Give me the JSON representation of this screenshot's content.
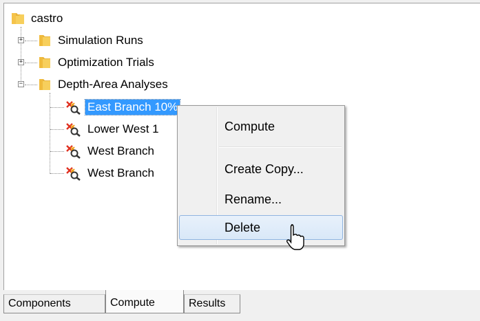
{
  "tree": {
    "root": {
      "label": "castro"
    },
    "groups": [
      {
        "label": "Simulation Runs",
        "expander": "+"
      },
      {
        "label": "Optimization Trials",
        "expander": "+"
      },
      {
        "label": "Depth-Area Analyses",
        "expander": "−"
      }
    ],
    "analyses": [
      {
        "label": "East Branch 10%",
        "selected": true
      },
      {
        "label": "Lower West 1"
      },
      {
        "label": "West Branch"
      },
      {
        "label": "West Branch"
      }
    ]
  },
  "context_menu": {
    "items": [
      {
        "label": "Compute"
      },
      {
        "label": "Create Copy..."
      },
      {
        "label": "Rename..."
      },
      {
        "label": "Delete",
        "hover": true
      }
    ]
  },
  "tabs": [
    {
      "label": "Components"
    },
    {
      "label": "Compute",
      "active": true
    },
    {
      "label": "Results"
    }
  ],
  "colors": {
    "selection": "#3399ff",
    "folder": "#f5c34a",
    "menu_hover": "#d9e8f8"
  }
}
